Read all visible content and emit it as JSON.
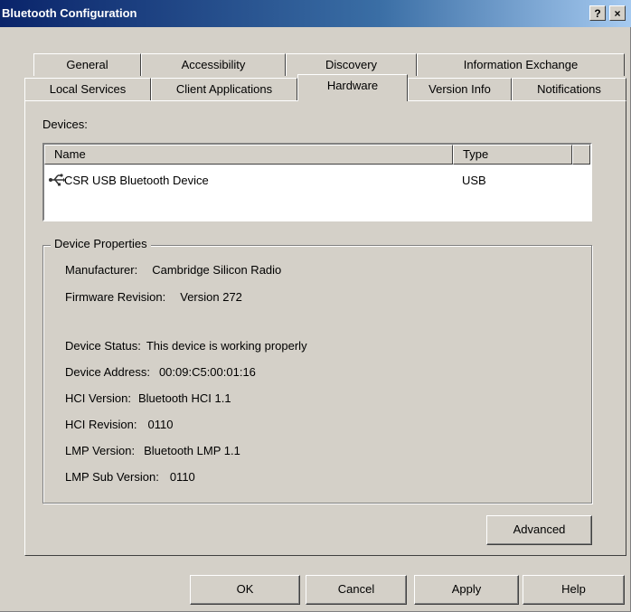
{
  "window": {
    "title": "Bluetooth Configuration",
    "help_button": "?",
    "close_button": "×"
  },
  "tabs": {
    "row1": [
      "General",
      "Accessibility",
      "Discovery",
      "Information Exchange"
    ],
    "row2": [
      "Local Services",
      "Client Applications",
      "Hardware",
      "Version Info",
      "Notifications"
    ],
    "selected": "Hardware"
  },
  "devices": {
    "label": "Devices:",
    "columns": [
      "Name",
      "Type"
    ],
    "rows": [
      {
        "name": "CSR USB Bluetooth Device",
        "type": "USB",
        "icon": "bluetooth-usb-icon"
      }
    ]
  },
  "device_properties": {
    "label": "Device Properties",
    "manufacturer_label": "Manufacturer:",
    "manufacturer": "Cambridge Silicon Radio",
    "firmware_label": "Firmware Revision:",
    "firmware": "Version 272",
    "status_label": "Device Status:",
    "status": "This device is working properly",
    "address_label": "Device Address:",
    "address": "00:09:C5:00:01:16",
    "hci_version_label": "HCI Version:",
    "hci_version": "Bluetooth HCI 1.1",
    "hci_revision_label": "HCI Revision:",
    "hci_revision": "0110",
    "lmp_version_label": "LMP Version:",
    "lmp_version": "Bluetooth LMP 1.1",
    "lmp_sub_label": "LMP Sub Version:",
    "lmp_sub": "0110"
  },
  "buttons": {
    "advanced": "Advanced",
    "ok": "OK",
    "cancel": "Cancel",
    "apply": "Apply",
    "help": "Help"
  }
}
